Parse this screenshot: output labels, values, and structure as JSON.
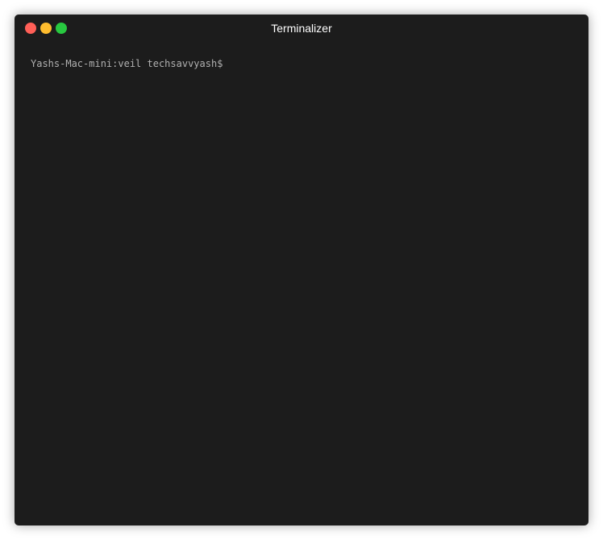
{
  "window": {
    "title": "Terminalizer",
    "background_color": "#1c1c1c",
    "controls": {
      "close": {
        "icon": "close-dot-icon",
        "color": "#ff5f57"
      },
      "minimize": {
        "icon": "minimize-dot-icon",
        "color": "#febc2e"
      },
      "zoom": {
        "icon": "zoom-dot-icon",
        "color": "#28c840"
      }
    }
  },
  "terminal": {
    "prompt": "Yashs-Mac-mini:veil techsavvyash$",
    "text_color": "#b0b0b0"
  }
}
